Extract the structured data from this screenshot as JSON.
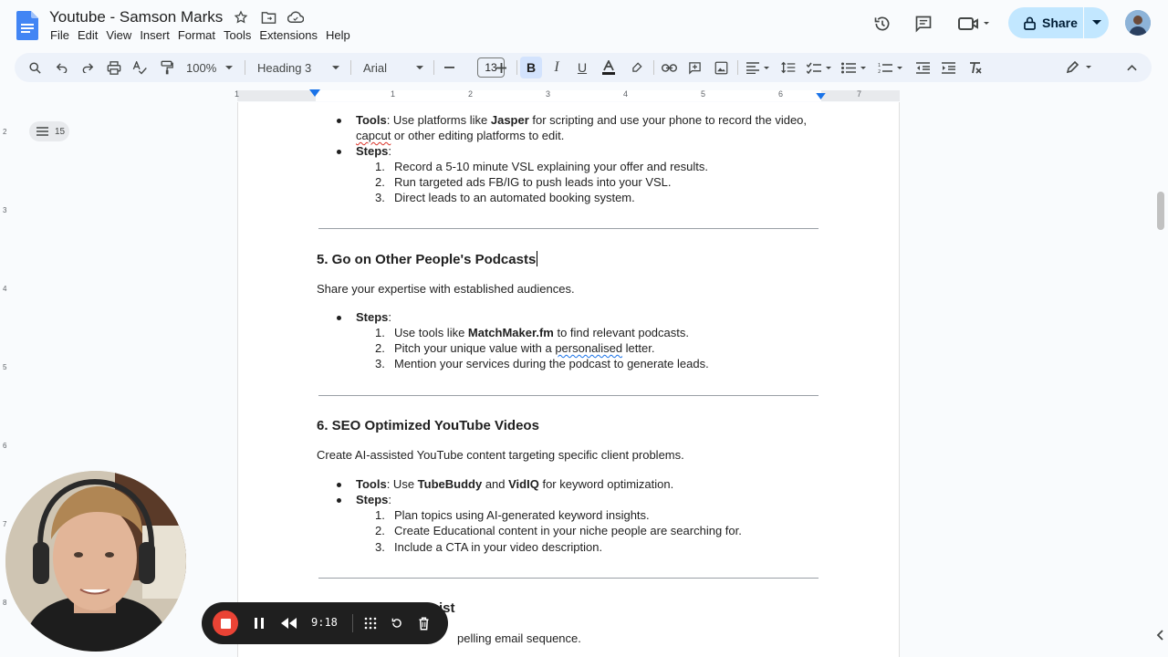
{
  "app": {
    "doc_title": "Youtube - Samson Marks",
    "menu": [
      "File",
      "Edit",
      "View",
      "Insert",
      "Format",
      "Tools",
      "Extensions",
      "Help"
    ],
    "share_label": "Share",
    "accent": "#c2e7ff"
  },
  "toolbar": {
    "zoom": "100%",
    "style": "Heading 3",
    "font": "Arial",
    "font_size": "13"
  },
  "ruler": {
    "h_numbers": [
      "1",
      "1",
      "2",
      "3",
      "4",
      "5",
      "6",
      "7"
    ],
    "v_numbers": [
      "2",
      "3",
      "4",
      "5",
      "6",
      "7",
      "8"
    ]
  },
  "outline": {
    "count": "15"
  },
  "doc": {
    "s4_tools_label": "Tools",
    "s4_tools_pre": ": Use platforms like ",
    "s4_tools_bold": "Jasper",
    "s4_tools_post": " for scripting and use your phone to record the video,",
    "s4_tools_line2_spell": "capcut",
    "s4_tools_line2": " or other editing platforms to edit.",
    "s4_steps_label": "Steps",
    "s4_steps": [
      "Record a 5-10 minute VSL explaining your offer and results.",
      "Run targeted ads FB/IG to push leads into  your VSL.",
      "Direct leads to an automated booking system."
    ],
    "s5_heading": "5. Go on Other People's Podcasts",
    "s5_intro": "Share your expertise with established audiences.",
    "s5_steps_label": "Steps",
    "s5_step1_pre": "Use tools like ",
    "s5_step1_bold": "MatchMaker.fm",
    "s5_step1_post": " to find relevant podcasts.",
    "s5_step2_pre": "Pitch your unique value with a ",
    "s5_step2_spell": "personalised",
    "s5_step2_post": " letter.",
    "s5_step3": "Mention your services during the podcast to generate leads.",
    "s6_heading": "6. SEO Optimized YouTube Videos",
    "s6_intro": "Create AI-assisted YouTube content targeting specific client problems.",
    "s6_tools_label": "Tools",
    "s6_tools_pre": ": Use ",
    "s6_tools_b1": "TubeBuddy",
    "s6_tools_mid": " and ",
    "s6_tools_b2": "VidIQ",
    "s6_tools_post": " for keyword optimization.",
    "s6_steps_label": "Steps",
    "s6_steps": [
      "Plan topics using AI-generated keyword insights.",
      "Create Educational content in your niche people are searching for.",
      "Include a CTA in your video description."
    ],
    "s7_heading_partial": "ist",
    "s7_intro_partial": "pelling email sequence."
  },
  "recorder": {
    "time": "9:18"
  }
}
